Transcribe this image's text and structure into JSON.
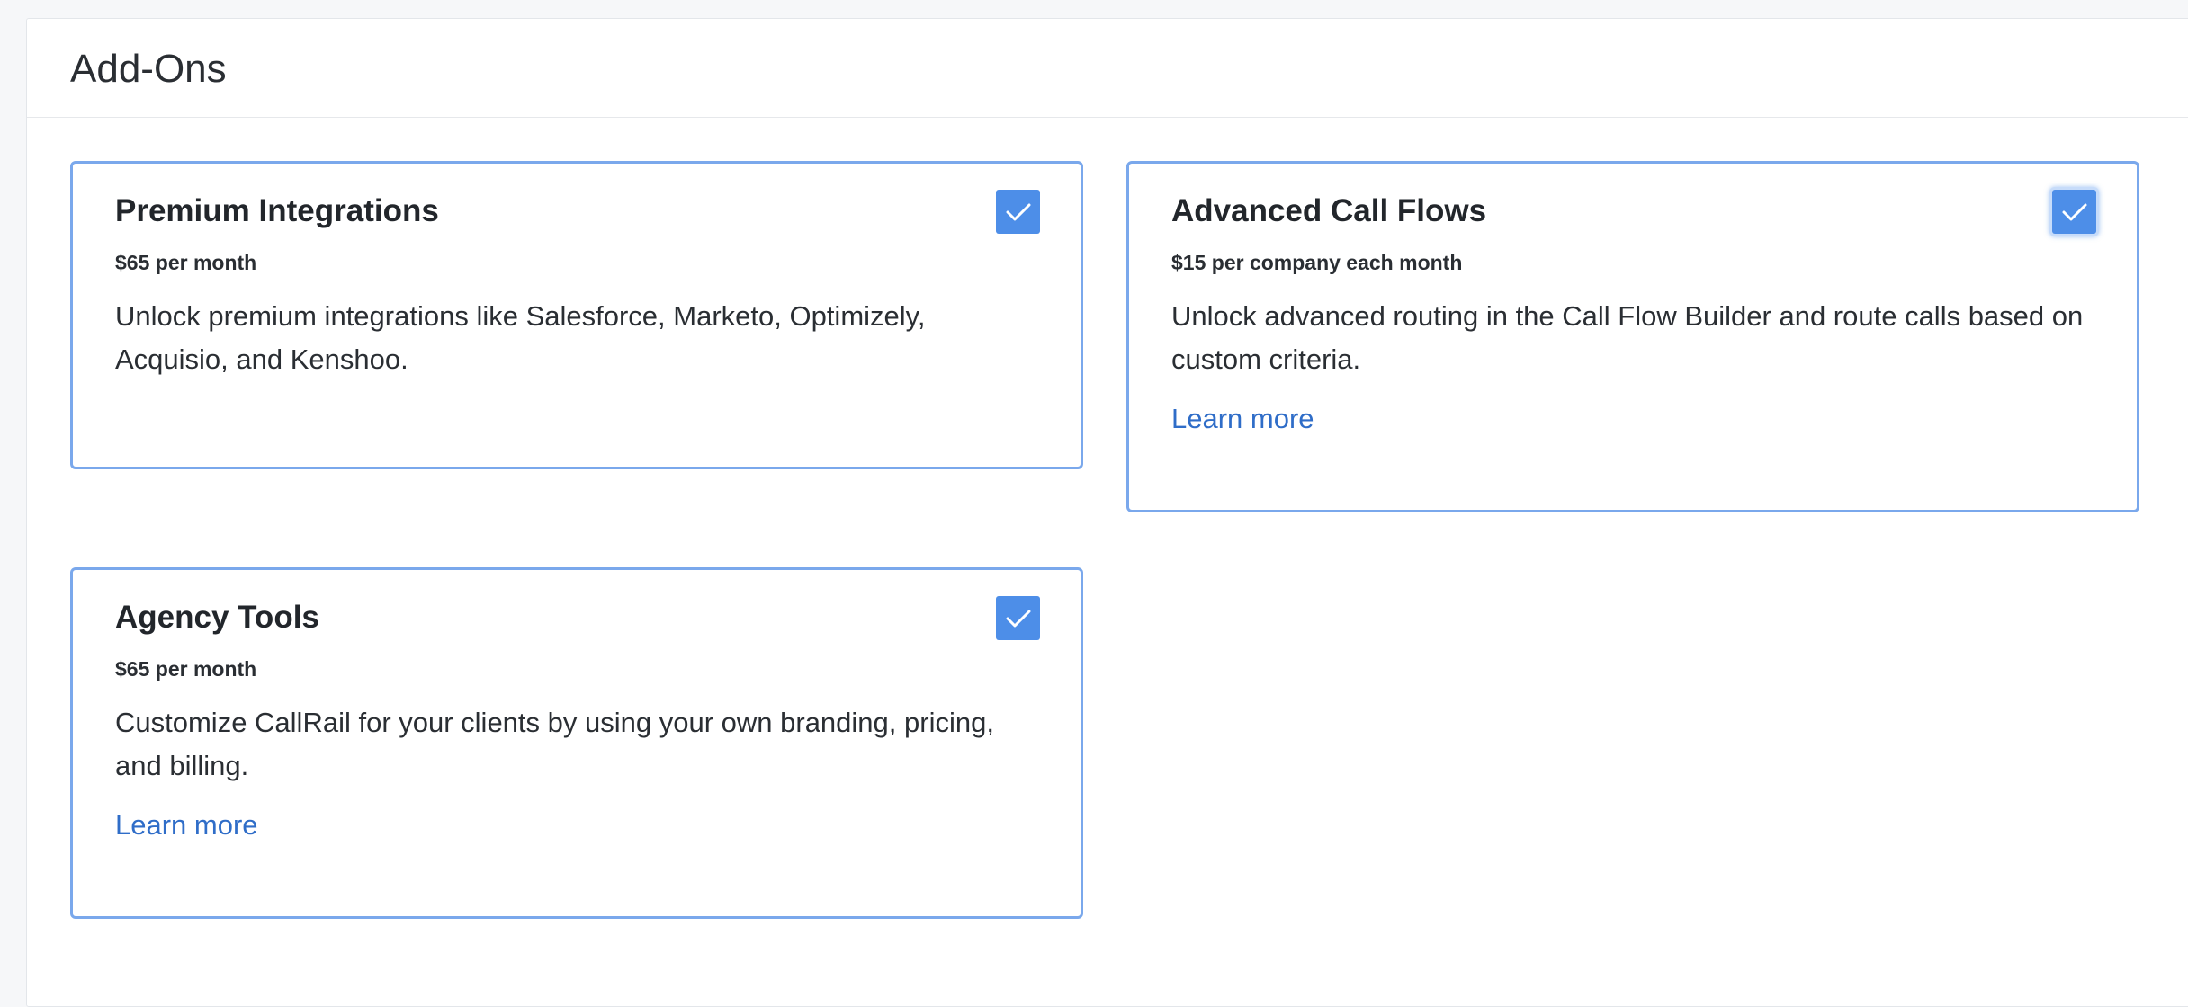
{
  "section": {
    "title": "Add-Ons"
  },
  "addons": [
    {
      "name": "Premium Integrations",
      "price": "$65 per month",
      "description": "Unlock premium integrations like Salesforce, Marketo, Optimizely, Acquisio, and Kenshoo.",
      "checked": true,
      "icon": "check-icon"
    },
    {
      "name": "Advanced Call Flows",
      "price": "$15 per company each month",
      "description": "Unlock advanced routing in the Call Flow Builder and route calls based on custom criteria.",
      "link": "Learn more",
      "checked": true,
      "icon": "check-icon"
    },
    {
      "name": "Agency Tools",
      "price": "$65 per month",
      "description": "Customize CallRail for your clients by using your own branding, pricing, and billing.",
      "link": "Learn more",
      "checked": true,
      "icon": "check-icon"
    }
  ],
  "colors": {
    "card_border": "#7aa8ec",
    "checkbox": "#4d8ee8",
    "link": "#2f6dc8"
  }
}
